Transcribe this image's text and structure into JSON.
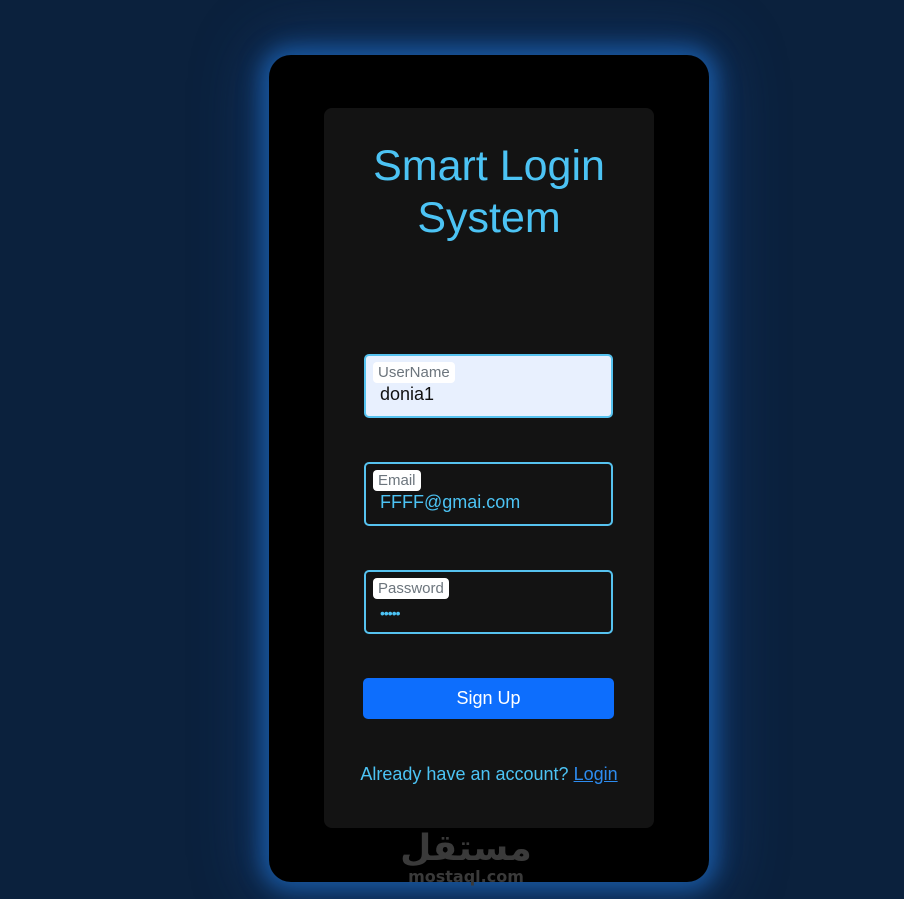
{
  "title": "Smart Login System",
  "fields": [
    {
      "label": "UserName",
      "value": "donia1"
    },
    {
      "label": "Email",
      "value": "FFFF@gmai.com"
    },
    {
      "label": "Password",
      "value": "•••••"
    }
  ],
  "signup_label": "Sign Up",
  "footer": {
    "prompt": "Already have an account?",
    "link": "Login"
  },
  "watermark": {
    "arabic": "مستقل",
    "latin": "mostaql.com"
  },
  "colors": {
    "background": "#0b213d",
    "accent": "#4cc3f4",
    "button": "#0d6efd",
    "link": "#2d8cf0"
  }
}
